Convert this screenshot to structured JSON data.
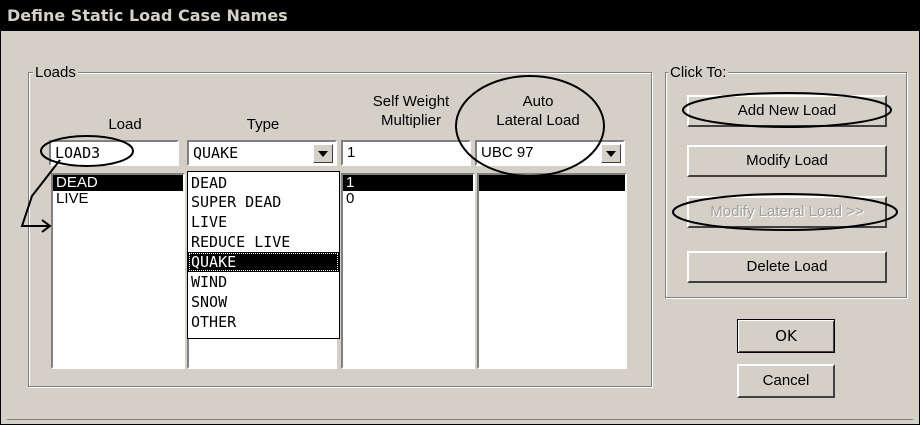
{
  "window": {
    "title": "Define Static Load Case Names"
  },
  "loads_group": {
    "legend": "Loads",
    "headers": {
      "load": "Load",
      "type": "Type",
      "self_weight_line1": "Self Weight",
      "self_weight_line2": "Multiplier",
      "auto_lateral_line1": "Auto",
      "auto_lateral_line2": "Lateral Load"
    },
    "inputs": {
      "load_name": "LOAD3",
      "type_value": "QUAKE",
      "self_weight": "1",
      "auto_lateral": "UBC 97"
    },
    "load_list": [
      "DEAD",
      "LIVE"
    ],
    "self_weight_list": [
      "1",
      "0"
    ],
    "type_options": [
      "DEAD",
      "SUPER DEAD",
      "LIVE",
      "REDUCE LIVE",
      "QUAKE",
      "WIND",
      "SNOW",
      "OTHER"
    ],
    "type_highlighted": "QUAKE"
  },
  "click_to_group": {
    "legend": "Click To:",
    "add_new_load": "Add New Load",
    "modify_load": "Modify Load",
    "modify_lateral_load": "Modify Lateral Load >>",
    "delete_load": "Delete Load"
  },
  "ok_button": "OK",
  "cancel_button": "Cancel"
}
